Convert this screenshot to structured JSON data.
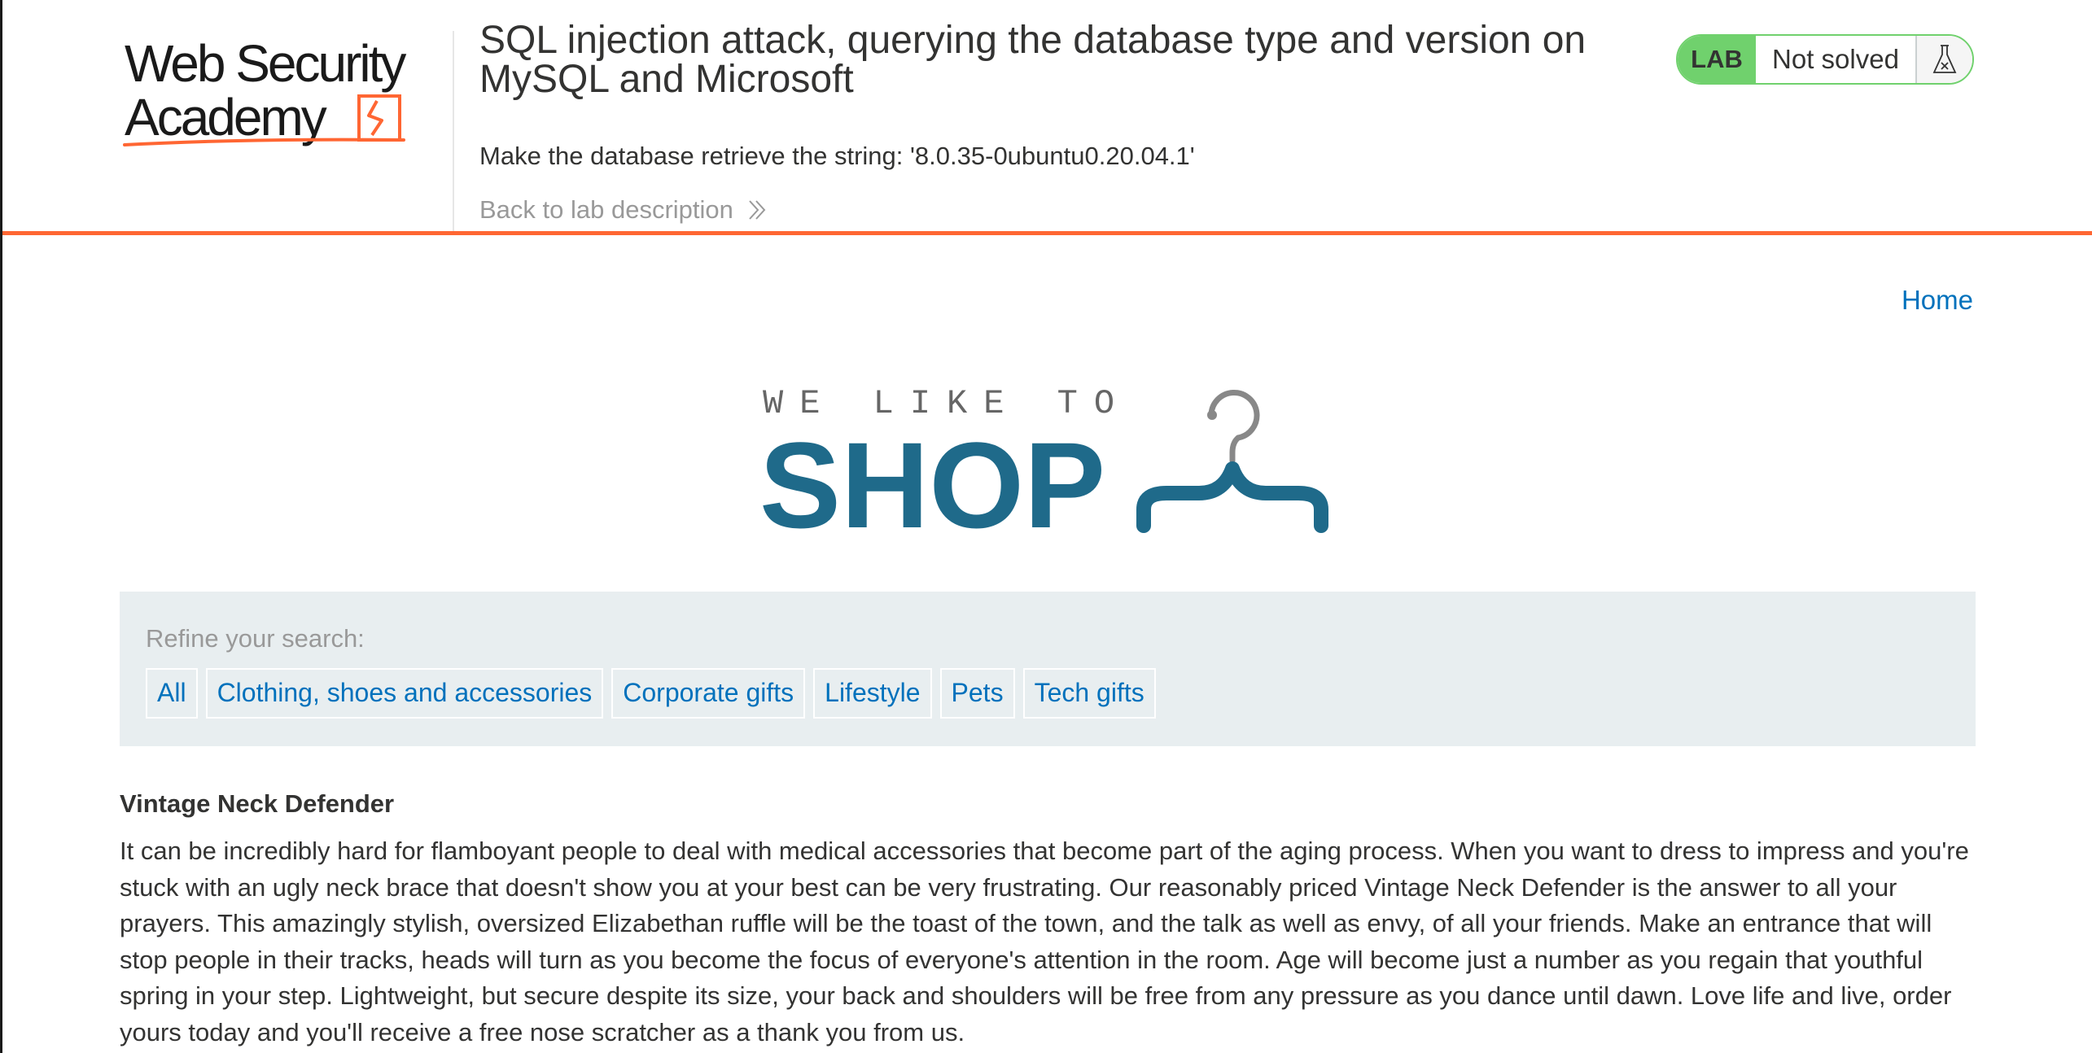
{
  "academy": {
    "logo_text_line1": "Web Security",
    "logo_text_line2": "Academy",
    "lab_title": "SQL injection attack, querying the database type and version on MySQL and Microsoft",
    "objective": "Make the database retrieve the string: '8.0.35-0ubuntu0.20.04.1'",
    "back_link": "Back to lab description",
    "status_badge": "LAB",
    "status_text": "Not solved",
    "colors": {
      "accent": "#ff6633",
      "lab_green": "#70d16d",
      "link": "#0071bc"
    }
  },
  "nav": {
    "home": "Home"
  },
  "shop_logo": {
    "line1": "WE LIKE TO",
    "line2": "SHOP",
    "color": "#1f6a8a"
  },
  "filters": {
    "label": "Refine your search:",
    "items": [
      "All",
      "Clothing, shoes and accessories",
      "Corporate gifts",
      "Lifestyle",
      "Pets",
      "Tech gifts"
    ]
  },
  "product": {
    "name": "Vintage Neck Defender",
    "description": "It can be incredibly hard for flamboyant people to deal with medical accessories that become part of the aging process. When you want to dress to impress and you're stuck with an ugly neck brace that doesn't show you at your best can be very frustrating. Our reasonably priced Vintage Neck Defender is the answer to all your prayers. This amazingly stylish, oversized Elizabethan ruffle will be the toast of the town, and the talk as well as envy, of all your friends. Make an entrance that will stop people in their tracks, heads will turn as you become the focus of everyone's attention in the room. Age will become just a number as you regain that youthful spring in your step. Lightweight, but secure despite its size, your back and shoulders will be free from any pressure as you dance until dawn. Love life and live, order yours today and you'll receive a free nose scratcher as a thank you from us."
  }
}
